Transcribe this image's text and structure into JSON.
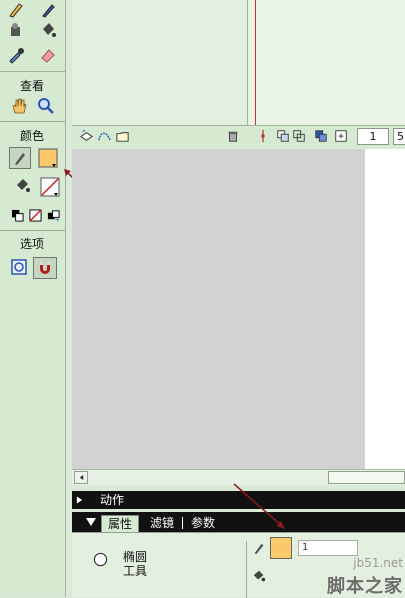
{
  "toolbox": {
    "view_title": "查看",
    "color_title": "颜色",
    "options_title": "选项",
    "fill_color": "#f9c96a"
  },
  "timeline": {
    "frame_value": "1",
    "frame_rate_partial": "5"
  },
  "panels": {
    "actions_label": "动作",
    "tab_properties": "属性",
    "tab_filters": "滤镜",
    "tab_params": "参数",
    "tool_name_line1": "椭圆",
    "tool_name_line2": "工具",
    "stroke_size_partial": "1"
  },
  "watermark": {
    "url": "jb51.net",
    "text": "脚本之家"
  },
  "colors": {
    "accent_arrow": "#8b1a1a",
    "panel_black": "#111111"
  }
}
